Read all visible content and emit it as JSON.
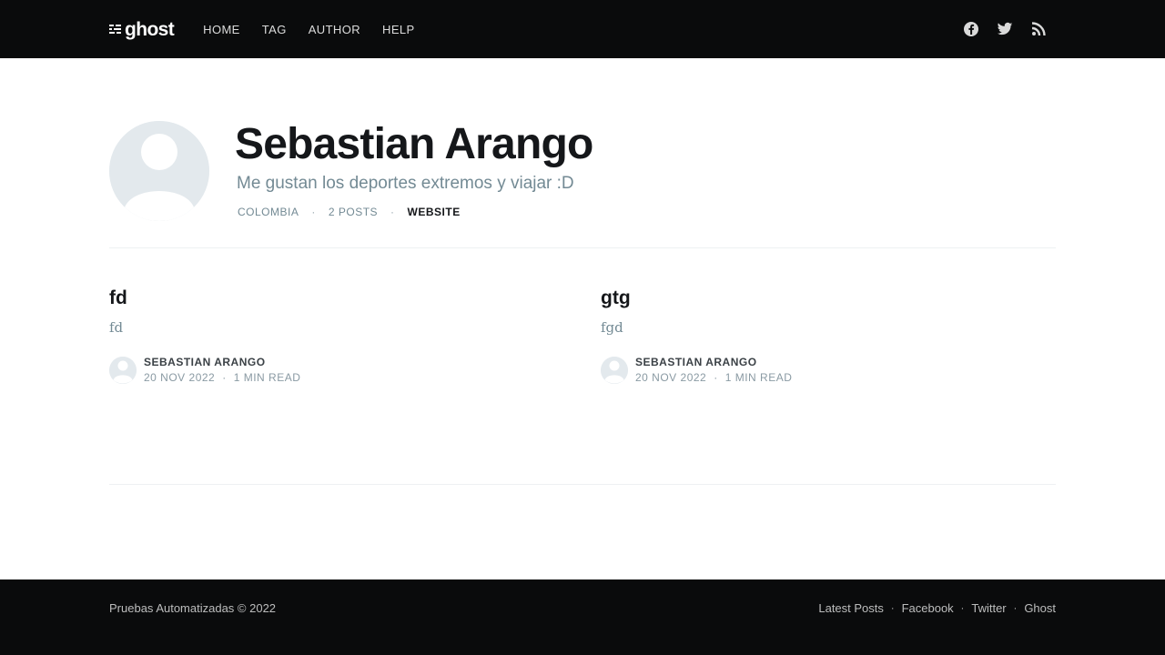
{
  "header": {
    "logo_text": "ghost",
    "nav": [
      "HOME",
      "TAG",
      "AUTHOR",
      "HELP"
    ],
    "social": [
      "facebook-icon",
      "twitter-icon",
      "rss-icon"
    ],
    "background": "#0a0b0c"
  },
  "author": {
    "name": "Sebastian Arango",
    "bio": "Me gustan los deportes extremos y viajar :D",
    "location": "COLOMBIA",
    "posts_count": "2 POSTS",
    "website": "WEBSITE",
    "separator": "·"
  },
  "posts": [
    {
      "title": "fd",
      "excerpt": "fd",
      "author": "SEBASTIAN ARANGO",
      "date": "20 NOV 2022",
      "separator": "·",
      "reading_time": "1 MIN READ"
    },
    {
      "title": "gtg",
      "excerpt": "fgd",
      "author": "SEBASTIAN ARANGO",
      "date": "20 NOV 2022",
      "separator": "·",
      "reading_time": "1 MIN READ"
    }
  ],
  "footer": {
    "copyright": "Pruebas Automatizadas © 2022",
    "links": [
      "Latest Posts",
      "Facebook",
      "Twitter",
      "Ghost"
    ],
    "separator": "·"
  },
  "colors": {
    "text": "#15171a",
    "muted": "#738a94",
    "avatar_bg": "#e3e9ed"
  }
}
